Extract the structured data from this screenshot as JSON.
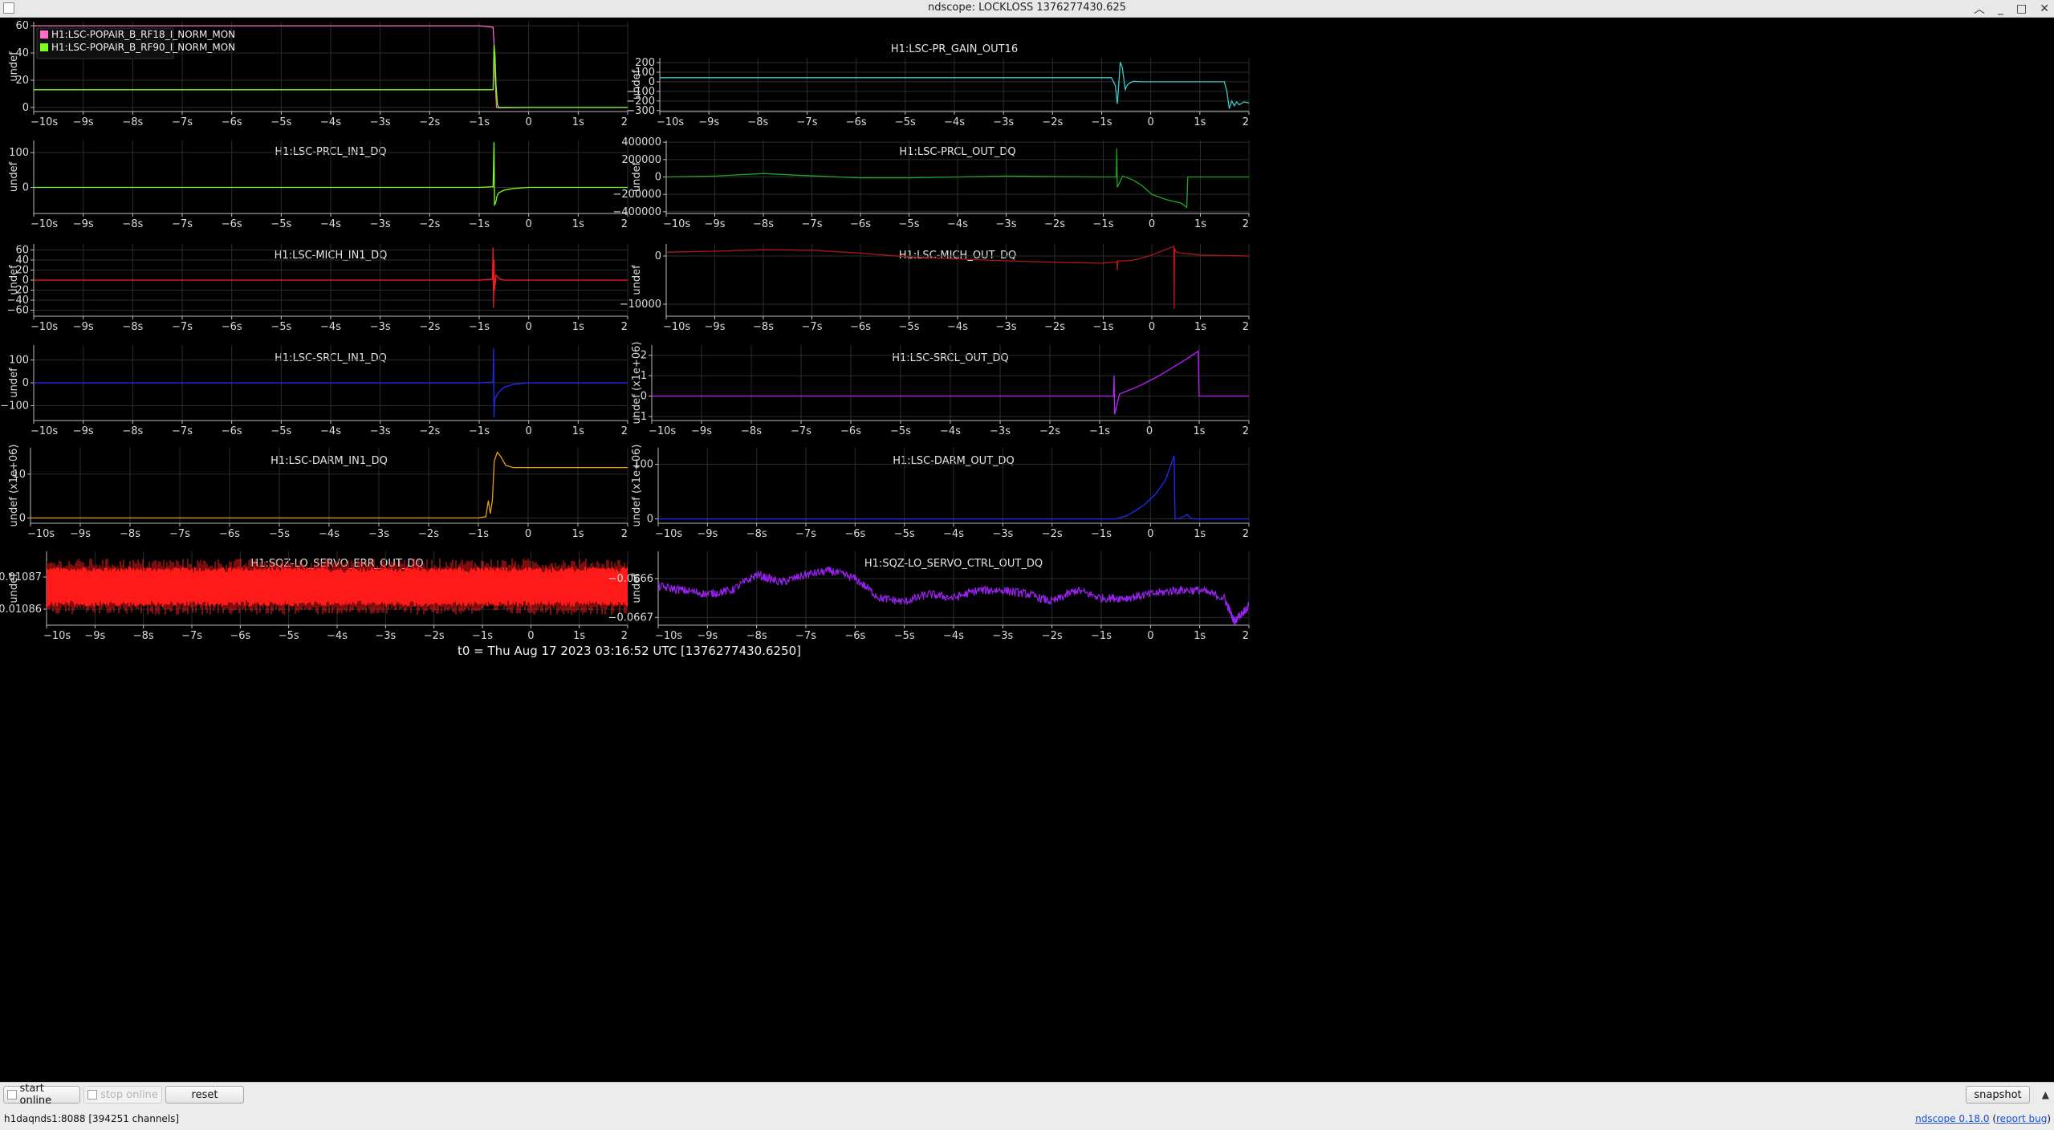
{
  "window": {
    "title": "ndscope: LOCKLOSS 1376277430.625"
  },
  "x_ticks": [
    "-10s",
    "-9s",
    "-8s",
    "-7s",
    "-6s",
    "-5s",
    "-4s",
    "-3s",
    "-2s",
    "-1s",
    "0",
    "1s",
    "2"
  ],
  "t0_label": "t0 = Thu Aug 17 2023 03:16:52 UTC [1376277430.6250]",
  "toolbar": {
    "start_online": "start online",
    "stop_online": "stop online",
    "reset": "reset",
    "snapshot": "snapshot",
    "collapse_icon": "chevron-up-icon"
  },
  "status": {
    "server": "h1daqnds1:8088",
    "channels": "[394251 channels]"
  },
  "links": {
    "version": "ndscope 0.18.0",
    "report_bug": "report bug"
  },
  "colors": {
    "background": "#000000",
    "grid": "#2c2c2c",
    "pink": "#ff6ec7",
    "green": "#7cff1a",
    "cyan": "#3fc9c9",
    "dkgreen": "#1fa81f",
    "red": "#ff1a1a",
    "dkred": "#b01818",
    "blue": "#1c2cff",
    "purple": "#c020ff",
    "orange": "#e5a010",
    "violet": "#9a22f0"
  },
  "chart_data": [
    {
      "type": "line",
      "id": "p1",
      "title": "",
      "ylabel": "undef",
      "ylim": [
        -3,
        63
      ],
      "yticks": [
        0,
        20,
        40,
        60
      ],
      "xlim": [
        -10,
        2
      ],
      "legend_position": "top-left",
      "series": [
        {
          "name": "H1:LSC-POPAIR_B_RF18_I_NORM_MON",
          "color": "pink",
          "x": [
            -10,
            -9,
            -8,
            -7,
            -6,
            -5,
            -4,
            -3,
            -2,
            -1,
            -0.72,
            -0.7,
            -0.68,
            -0.65,
            -0.6,
            0,
            1,
            2
          ],
          "y": [
            60,
            60,
            60,
            60,
            60,
            60,
            60,
            60,
            60,
            60,
            59,
            47,
            22,
            0,
            -0.3,
            0,
            0,
            0
          ]
        },
        {
          "name": "H1:LSC-POPAIR_B_RF90_I_NORM_MON",
          "color": "green",
          "x": [
            -10,
            -9,
            -8,
            -7,
            -6,
            -5,
            -4,
            -3,
            -2,
            -1,
            -0.72,
            -0.7,
            -0.68,
            -0.66,
            -0.63,
            -0.6,
            0,
            1,
            2
          ],
          "y": [
            13,
            13,
            13,
            13,
            13,
            13,
            13,
            13,
            13,
            13,
            13,
            46,
            38,
            16,
            2,
            0,
            0,
            0,
            0
          ]
        }
      ]
    },
    {
      "type": "line",
      "id": "p2",
      "title": "H1:LSC-PR_GAIN_OUT16",
      "ylabel": "undef",
      "ylim": [
        -310,
        250
      ],
      "yticks": [
        200,
        100,
        0,
        -100,
        -200,
        -300
      ],
      "xlim": [
        -10,
        2
      ],
      "series": [
        {
          "name": "",
          "color": "cyan",
          "x": [
            -10,
            -9,
            -8,
            -7,
            -6,
            -5,
            -4,
            -3,
            -2,
            -1,
            -0.8,
            -0.72,
            -0.68,
            -0.62,
            -0.58,
            -0.52,
            -0.48,
            -0.42,
            -0.35,
            -0.2,
            0,
            0.5,
            1,
            1.5,
            1.55,
            1.6,
            1.65,
            1.7,
            1.75,
            1.8,
            1.9,
            2
          ],
          "y": [
            43,
            43,
            43,
            43,
            43,
            43,
            43,
            43,
            43,
            43,
            43,
            -40,
            -230,
            205,
            150,
            -80,
            -35,
            -10,
            5,
            0,
            0,
            0,
            0,
            0,
            -100,
            -280,
            -200,
            -250,
            -210,
            -240,
            -210,
            -220
          ]
        }
      ]
    },
    {
      "type": "line",
      "id": "p3",
      "title": "H1:LSC-PRCL_IN1_DQ",
      "ylabel": "undef",
      "ylim": [
        -75,
        135
      ],
      "yticks": [
        100,
        0
      ],
      "xlim": [
        -10,
        2
      ],
      "series": [
        {
          "name": "",
          "color": "green",
          "x": [
            -10,
            -9,
            -8,
            -7,
            -6,
            -5,
            -4,
            -3,
            -2,
            -1,
            -0.72,
            -0.7,
            -0.69,
            -0.67,
            -0.64,
            -0.6,
            -0.5,
            -0.3,
            0,
            1,
            2
          ],
          "y": [
            0,
            0,
            0,
            0,
            0,
            0,
            0,
            0,
            0,
            0,
            2,
            130,
            -50,
            -45,
            -25,
            -15,
            -8,
            -3,
            0,
            0,
            0
          ]
        }
      ]
    },
    {
      "type": "line",
      "id": "p4",
      "title": "H1:LSC-PRCL_OUT_DQ",
      "ylabel": "undef",
      "ylim": [
        -420000,
        420000
      ],
      "yticks": [
        400000,
        200000,
        0,
        -200000,
        -400000
      ],
      "xlim": [
        -10,
        2
      ],
      "series": [
        {
          "name": "",
          "color": "dkgreen",
          "x": [
            -10,
            -9,
            -8,
            -7.3,
            -6,
            -5,
            -4,
            -3,
            -2,
            -1,
            -0.73,
            -0.72,
            -0.71,
            -0.6,
            -0.4,
            -0.2,
            0,
            0.3,
            0.6,
            0.72,
            0.74,
            0.8,
            1,
            2
          ],
          "y": [
            0,
            10000,
            40000,
            20000,
            -10000,
            -10000,
            0,
            10000,
            5000,
            0,
            0,
            330000,
            -120000,
            10000,
            -30000,
            -100000,
            -200000,
            -260000,
            -300000,
            -350000,
            0,
            0,
            0,
            0
          ]
        }
      ]
    },
    {
      "type": "line",
      "id": "p5",
      "title": "H1:LSC-MICH_IN1_DQ",
      "ylabel": "undef",
      "ylim": [
        -72,
        72
      ],
      "yticks": [
        60,
        40,
        20,
        0,
        -20,
        -40,
        -60
      ],
      "xlim": [
        -10,
        2
      ],
      "series": [
        {
          "name": "",
          "color": "red",
          "x": [
            -10,
            -9,
            -8,
            -7,
            -6,
            -5,
            -4,
            -3,
            -2,
            -1,
            -0.73,
            -0.72,
            -0.71,
            -0.7,
            -0.69,
            -0.66,
            -0.6,
            -0.5,
            0,
            1,
            2
          ],
          "y": [
            0,
            0,
            0,
            0,
            0,
            0,
            0,
            0,
            0,
            0,
            2,
            65,
            -55,
            40,
            -20,
            10,
            3,
            0,
            0,
            0,
            0
          ]
        }
      ]
    },
    {
      "type": "line",
      "id": "p6",
      "title": "H1:LSC-MICH_OUT_DQ",
      "ylabel": "undef",
      "ylim": [
        -12500,
        2500
      ],
      "yticks": [
        0,
        -10000
      ],
      "xlim": [
        -10,
        2
      ],
      "series": [
        {
          "name": "",
          "color": "dkred",
          "x": [
            -10,
            -9,
            -8,
            -7,
            -6,
            -5,
            -4,
            -3,
            -2,
            -1,
            -0.72,
            -0.71,
            -0.7,
            -0.5,
            -0.3,
            0,
            0.2,
            0.4,
            0.45,
            0.46,
            0.47,
            0.5,
            0.6,
            1,
            1.5,
            2
          ],
          "y": [
            800,
            1000,
            1300,
            1200,
            600,
            -200,
            -600,
            -1000,
            -1300,
            -1500,
            -1200,
            -3000,
            -1000,
            -1000,
            -700,
            200,
            1000,
            1800,
            2000,
            -11000,
            1600,
            800,
            600,
            200,
            100,
            0
          ]
        }
      ]
    },
    {
      "type": "line",
      "id": "p7",
      "title": "H1:LSC-SRCL_IN1_DQ",
      "ylabel": "undef",
      "ylim": [
        -165,
        165
      ],
      "yticks": [
        100,
        0,
        -100
      ],
      "xlim": [
        -10,
        2
      ],
      "series": [
        {
          "name": "",
          "color": "blue",
          "x": [
            -10,
            -9,
            -8,
            -7,
            -6,
            -5,
            -4,
            -3,
            -2,
            -1,
            -0.72,
            -0.71,
            -0.7,
            -0.69,
            -0.66,
            -0.6,
            -0.5,
            -0.3,
            0,
            1,
            2
          ],
          "y": [
            0,
            0,
            0,
            0,
            0,
            0,
            0,
            0,
            0,
            0,
            3,
            150,
            -150,
            -80,
            -60,
            -40,
            -20,
            -6,
            0,
            0,
            0
          ]
        }
      ]
    },
    {
      "type": "line",
      "id": "p8",
      "title": "H1:LSC-SRCL_OUT_DQ",
      "ylabel": "undef (x1e+06)",
      "ylim": [
        -1.2,
        2.5
      ],
      "yticks": [
        2,
        1,
        0,
        -1
      ],
      "xlim": [
        -10,
        2
      ],
      "series": [
        {
          "name": "",
          "color": "purple",
          "x": [
            -10,
            -9,
            -8,
            -7,
            -6,
            -5,
            -4,
            -3,
            -2,
            -1,
            -0.72,
            -0.71,
            -0.7,
            -0.6,
            -0.4,
            -0.2,
            0,
            0.2,
            0.4,
            0.6,
            0.8,
            0.98,
            1.0,
            1.5,
            2
          ],
          "y": [
            0,
            0,
            0,
            0,
            0,
            0,
            0,
            0,
            0,
            0,
            0,
            1,
            -0.9,
            0.1,
            0.3,
            0.5,
            0.75,
            1.0,
            1.3,
            1.6,
            1.9,
            2.2,
            0,
            0,
            0
          ]
        }
      ]
    },
    {
      "type": "line",
      "id": "p9",
      "title": "H1:LSC-DARM_IN1_DQ",
      "ylabel": "undef (x1e+06)",
      "ylim": [
        -1.2,
        16
      ],
      "yticks": [
        10,
        0
      ],
      "xlim": [
        -10,
        2
      ],
      "series": [
        {
          "name": "",
          "color": "orange",
          "x": [
            -10,
            -9,
            -8,
            -7,
            -6,
            -5,
            -4,
            -3,
            -2,
            -1,
            -0.85,
            -0.8,
            -0.76,
            -0.72,
            -0.68,
            -0.62,
            -0.55,
            -0.45,
            -0.3,
            0,
            1,
            2
          ],
          "y": [
            0,
            0,
            0,
            0,
            0,
            0,
            0,
            0,
            0,
            0,
            0.3,
            4,
            1,
            4,
            13,
            15,
            14,
            12,
            11.5,
            11.5,
            11.5,
            11.5
          ]
        }
      ]
    },
    {
      "type": "line",
      "id": "p10",
      "title": "H1:LSC-DARM_OUT_DQ",
      "ylabel": "undef (x1e+06)",
      "ylim": [
        -8,
        130
      ],
      "yticks": [
        100,
        0
      ],
      "xlim": [
        -10,
        2
      ],
      "series": [
        {
          "name": "",
          "color": "blue",
          "x": [
            -10,
            -9,
            -8,
            -7,
            -6,
            -5,
            -4,
            -3,
            -2,
            -1,
            -0.7,
            -0.5,
            -0.3,
            -0.1,
            0.1,
            0.3,
            0.48,
            0.5,
            0.6,
            0.75,
            0.8,
            0.9,
            1,
            2
          ],
          "y": [
            0,
            0,
            0,
            0,
            0,
            0,
            0,
            0,
            0,
            0,
            0,
            5,
            15,
            28,
            45,
            70,
            115,
            0,
            1,
            8,
            2,
            0,
            0,
            0
          ]
        }
      ]
    },
    {
      "type": "line",
      "id": "p11",
      "title": "H1:SQZ-LO_SERVO_ERR_OUT_DQ",
      "ylabel": "undef",
      "ylim": [
        0.010855,
        0.010878
      ],
      "yticks": [
        0.01087,
        0.01086
      ],
      "xlim": [
        -10,
        2
      ],
      "band": {
        "center": 0.010867,
        "half_width": 5.5e-06
      },
      "series": [
        {
          "name": "",
          "color": "red",
          "x": [],
          "y": []
        }
      ]
    },
    {
      "type": "line",
      "id": "p12",
      "title": "H1:SQZ-LO_SERVO_CTRL_OUT_DQ",
      "ylabel": "undef",
      "ylim": [
        -0.06672,
        -0.06653
      ],
      "yticks": [
        -0.0666,
        -0.0667
      ],
      "xlim": [
        -10,
        2
      ],
      "series": [
        {
          "name": "",
          "color": "violet",
          "x": [
            -10,
            -9.5,
            -9,
            -8.5,
            -8,
            -7.5,
            -7,
            -6.5,
            -6,
            -5.5,
            -5,
            -4.5,
            -4,
            -3.5,
            -3,
            -2.5,
            -2,
            -1.5,
            -1,
            -0.5,
            0,
            0.5,
            1,
            1.5,
            1.7,
            2
          ],
          "y": [
            -0.06662,
            -0.06663,
            -0.06664,
            -0.06663,
            -0.06659,
            -0.06661,
            -0.06659,
            -0.06658,
            -0.0666,
            -0.06665,
            -0.06666,
            -0.06664,
            -0.06665,
            -0.06663,
            -0.06663,
            -0.06664,
            -0.06666,
            -0.06663,
            -0.06665,
            -0.06665,
            -0.06664,
            -0.06663,
            -0.06663,
            -0.06665,
            -0.06671,
            -0.06667
          ]
        }
      ]
    }
  ]
}
